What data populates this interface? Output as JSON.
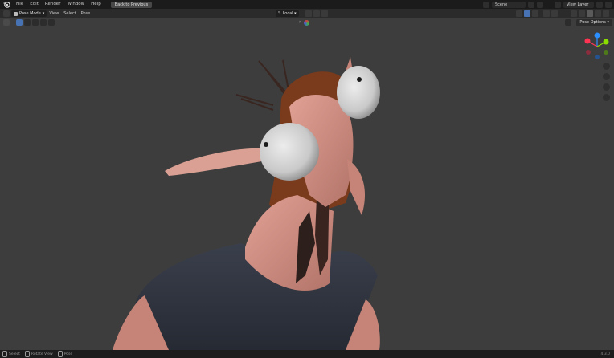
{
  "topbar": {
    "menu": [
      "File",
      "Edit",
      "Render",
      "Window",
      "Help"
    ],
    "back_button": "Back to Previous",
    "scene": "Scene",
    "view_layer": "View Layer"
  },
  "header": {
    "mode": "Pose Mode",
    "menus": [
      "View",
      "Select",
      "Pose"
    ],
    "orientation": "Local"
  },
  "toolbar": {
    "pose_options": "Pose Options"
  },
  "gizmo": {
    "x": "X",
    "y": "Y",
    "z": "Z"
  },
  "statusbar": {
    "items": [
      "Select",
      "Rotate View",
      "Pose"
    ],
    "version": "4.3.0"
  }
}
